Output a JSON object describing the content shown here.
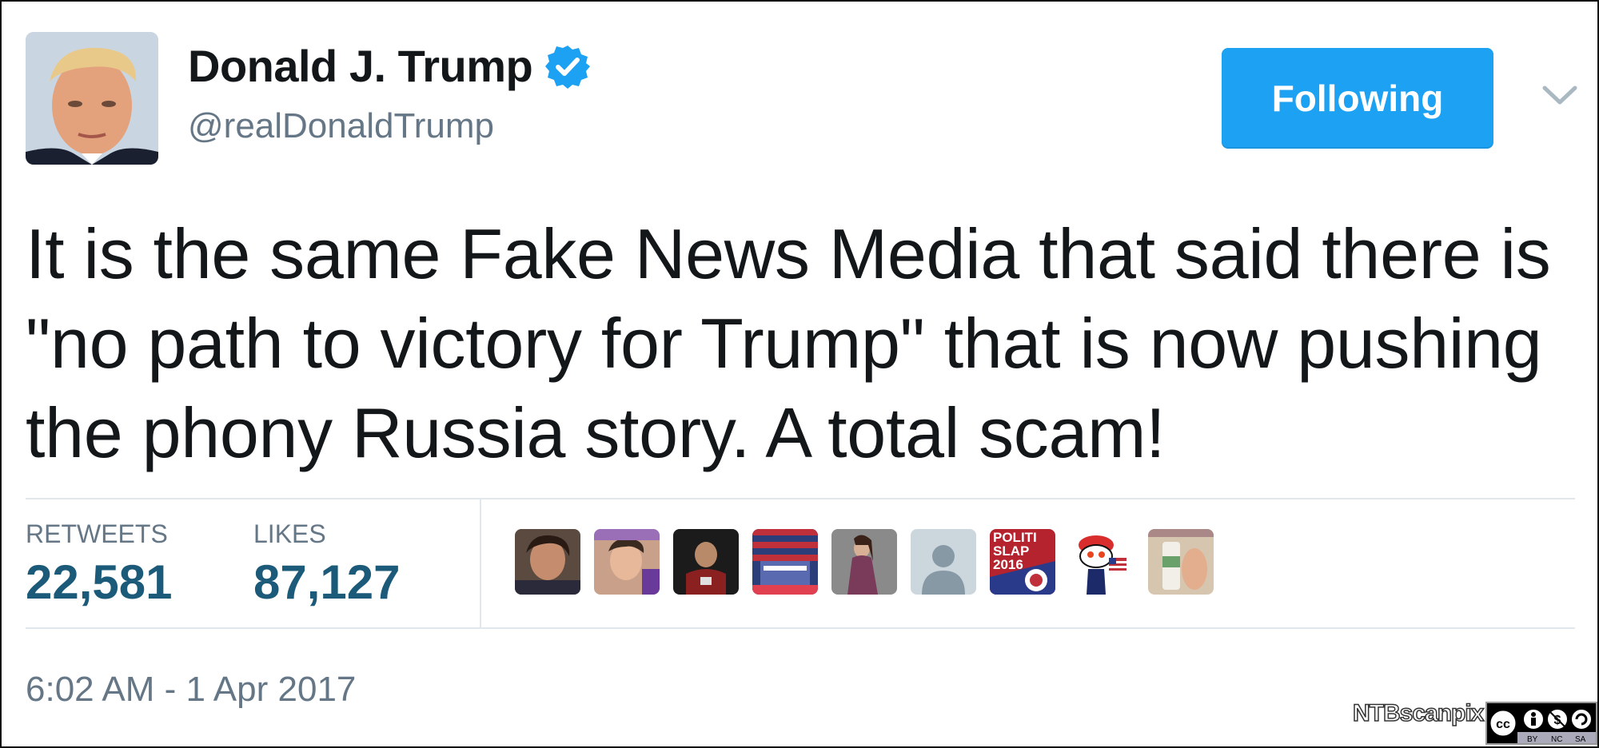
{
  "tweet": {
    "author": {
      "name": "Donald J. Trump",
      "handle": "@realDonaldTrump",
      "verified": true,
      "avatar_icon": "profile-photo"
    },
    "follow_button": {
      "label": "Following",
      "color": "#1da1f2"
    },
    "menu_icon": "chevron-down-icon",
    "text": "It is the same Fake News Media that said there is \"no path to victory for Trump\" that is now pushing the phony Russia story. A total scam!",
    "stats": {
      "retweets_label": "RETWEETS",
      "retweets_value": "22,581",
      "likes_label": "LIKES",
      "likes_value": "87,127"
    },
    "likers": [
      {
        "name": "liker-1"
      },
      {
        "name": "liker-2"
      },
      {
        "name": "liker-3"
      },
      {
        "name": "liker-4"
      },
      {
        "name": "liker-5"
      },
      {
        "name": "liker-6-default"
      },
      {
        "name": "liker-7-politislap",
        "text": "POLITI SLAP 2016"
      },
      {
        "name": "liker-8-mascot"
      },
      {
        "name": "liker-9"
      }
    ],
    "timestamp": "6:02 AM - 1 Apr 2017"
  },
  "watermark": {
    "credit": "NTBscanpix",
    "license": "CC BY NC SA"
  }
}
